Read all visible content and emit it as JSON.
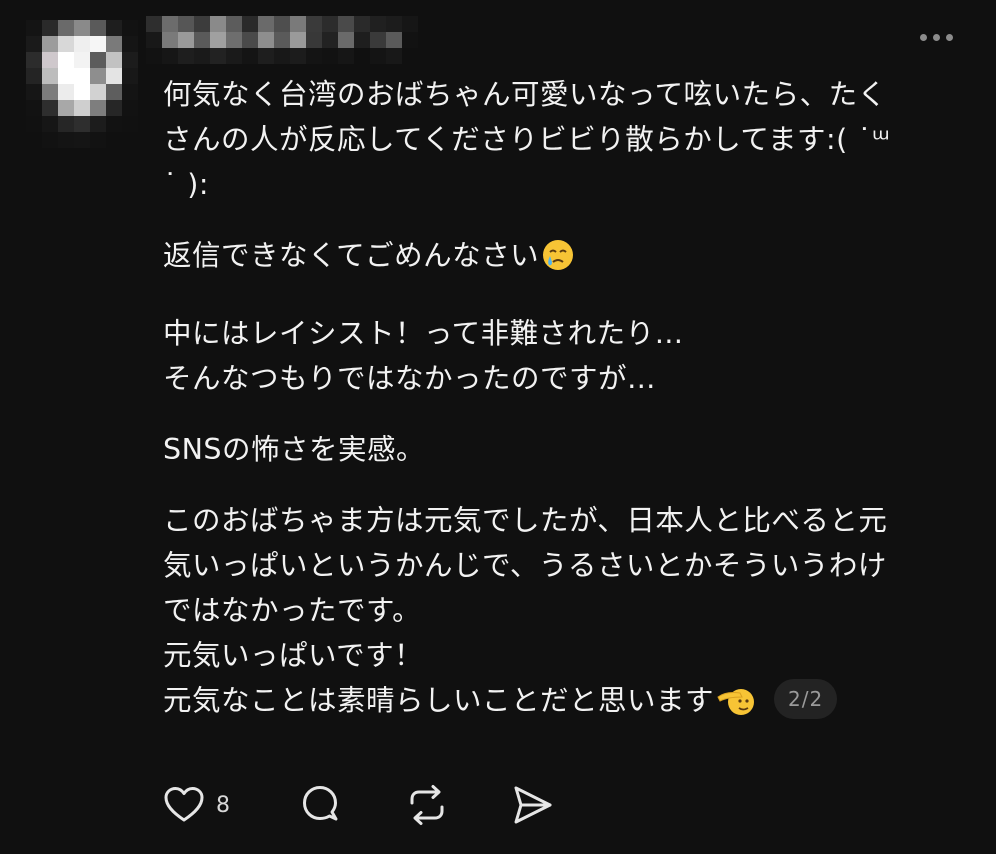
{
  "post": {
    "author": {
      "username_blurred": true,
      "avatar_blurred": true
    },
    "more_icon": "more-horizontal-icon",
    "lines": [
      "何気なく台湾のおばちゃん可愛いなって呟いたら、たく",
      "さんの人が反応してくださりビビり散らかしてます:( ˙ᵚ",
      "˙ ):",
      "返信できなくてごめんなさい",
      "中にはレイシスト！って非難されたり…",
      "そんなつもりではなかったのですが…",
      "SNSの怖さを実感。",
      "このおばちゃま方は元気でしたが、日本人と比べると元",
      "気いっぱいというかんじで、うるさいとかそういうわけ",
      "ではなかったです。",
      "元気いっぱいです！",
      "元気なことは素晴らしいことだと思います"
    ],
    "emojis": {
      "crying_face": "face-holding-back-tears-emoji",
      "saluting_face": "saluting-face-emoji"
    },
    "page_indicator": "2/2"
  },
  "actions": {
    "like_icon": "heart-icon",
    "like_count": "8",
    "comment_icon": "comment-icon",
    "repost_icon": "repost-icon",
    "share_icon": "send-icon"
  },
  "colors": {
    "background": "#101010",
    "text": "#f2f2f2",
    "muted": "#8c8c8c",
    "badge_bg": "#232323"
  }
}
